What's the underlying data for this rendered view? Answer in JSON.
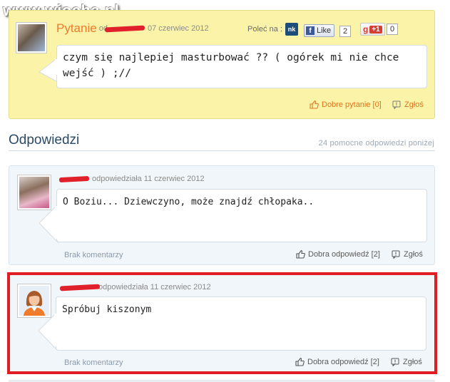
{
  "watermark": {
    "text": "www.wiocha.pl"
  },
  "question": {
    "label": "Pytanie",
    "meta_prefix": "od",
    "date": "07 czerwiec 2012",
    "recommend_label": "Poleć na :",
    "nk_label": "nk",
    "fb_like_label": "Like",
    "fb_like_count": "2",
    "gplus_label": "+1",
    "gplus_count": "0",
    "text": "czym się najlepiej masturbować ?? ( ogórek mi nie chce wejść ) ;//",
    "good_question_label": "Dobre pytanie [0]",
    "report_label": "Zgłoś"
  },
  "answers_section": {
    "title": "Odpowiedzi",
    "helpful_count": "24 pomocne odpowiedzi poniżej"
  },
  "answers": [
    {
      "meta": "odpowiedziała 11 czerwiec 2012",
      "text": "O Boziu... Dziewczyno, może znajdź chłopaka..",
      "comments_label": "Brak komentarzy",
      "good_answer_label": "Dobra odpowiedź [2]",
      "report_label": "Zgłoś"
    },
    {
      "meta": "odpowiedziała 11 czerwiec 2012",
      "text": "Spróbuj kiszonym",
      "comments_label": "Brak komentarzy",
      "good_answer_label": "Dobra odpowiedź [2]",
      "report_label": "Zgłoś"
    }
  ],
  "colors": {
    "question_bg": "#fbf4a8",
    "answer_bg": "#f1f6fa",
    "highlight_border": "#e11d24",
    "question_label": "#f07a2e",
    "section_title": "#2b4a66"
  },
  "icons": {
    "thumbs_up": "thumbs-up-icon",
    "report": "report-flag-icon"
  }
}
